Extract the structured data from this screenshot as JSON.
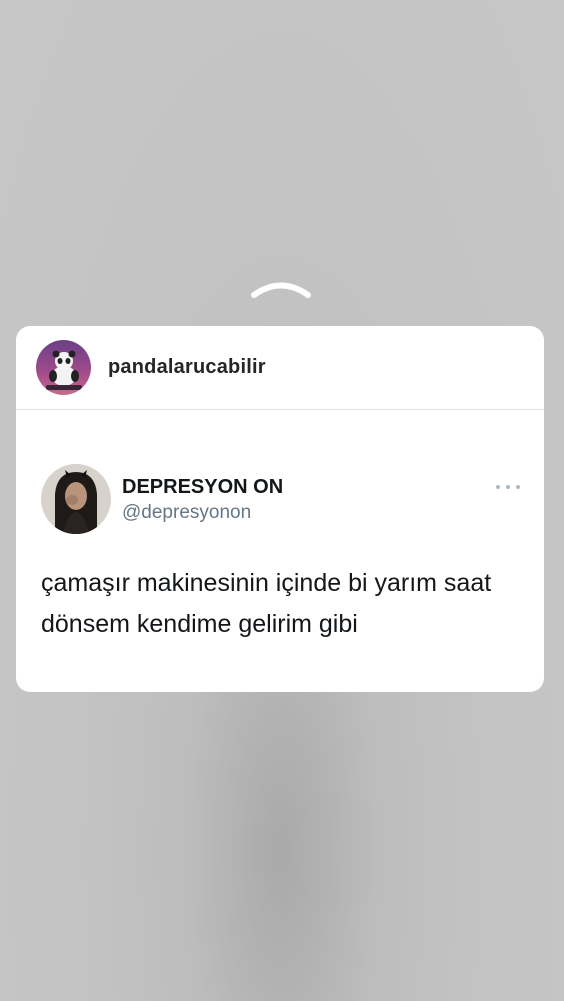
{
  "post": {
    "username": "pandalarucabilir",
    "avatar_icon": "panda-avatar"
  },
  "tweet": {
    "display_name": "DEPRESYON ON",
    "handle": "@depresyonon",
    "avatar_icon": "profile-avatar",
    "more_icon": "more-icon",
    "text": "çamaşır makinesinin içinde bi yarım saat dönsem kendime gelirim gibi"
  },
  "gesture": {
    "icon": "chevron-up-icon"
  },
  "colors": {
    "background": "#c4c4c4",
    "card": "#ffffff",
    "handle": "#657786",
    "text": "#14171a"
  }
}
